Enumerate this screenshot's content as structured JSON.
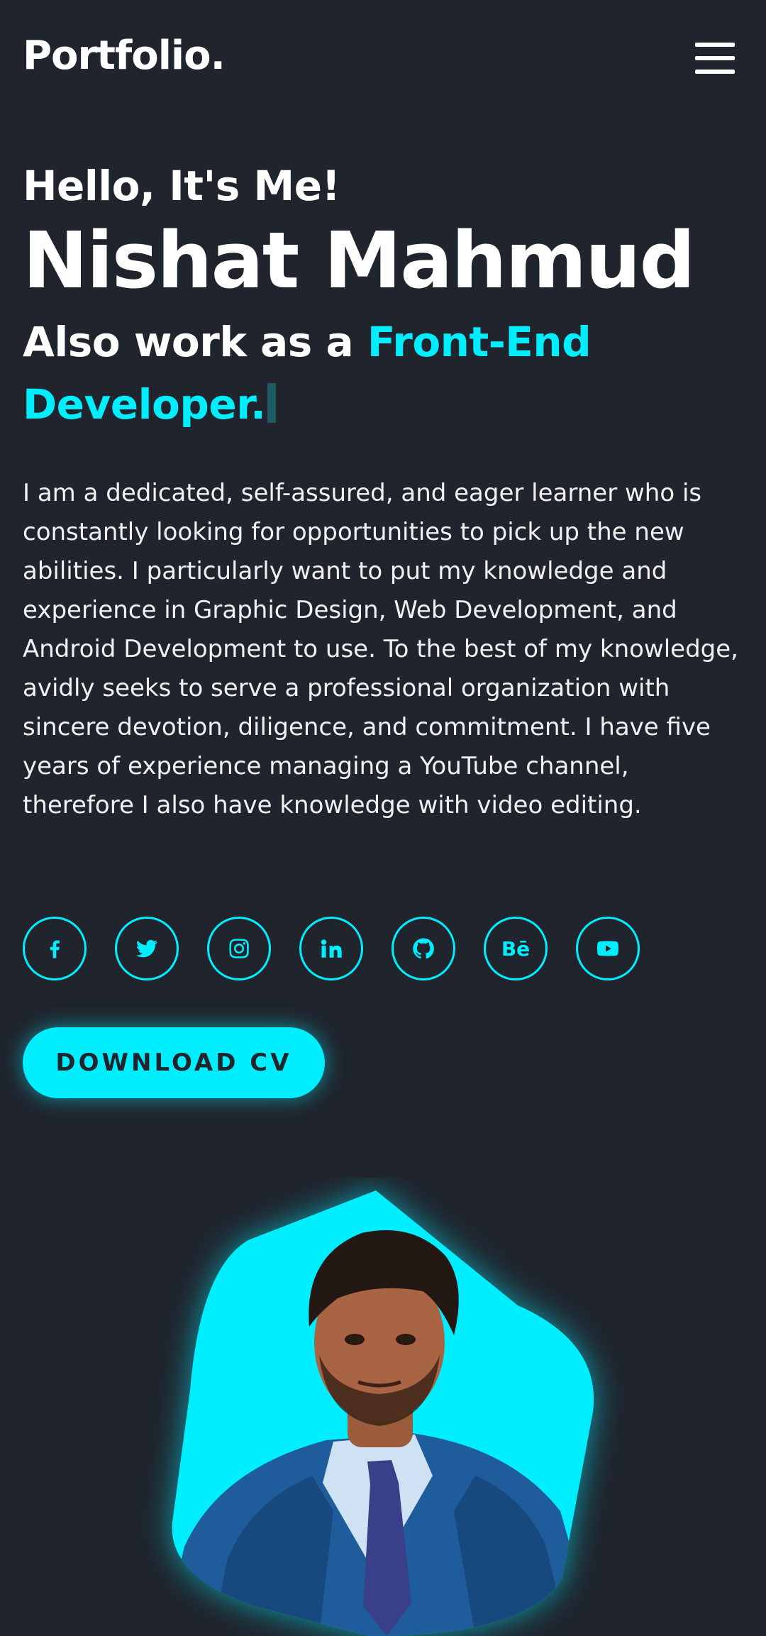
{
  "header": {
    "logo": "Portfolio.",
    "menu_icon": "hamburger-menu-icon"
  },
  "home": {
    "greeting": "Hello, It's Me!",
    "name": "Nishat Mahmud",
    "role_prefix": "Also work as a ",
    "role_typed": "Front-End Developer.",
    "bio": "I am a dedicated, self-assured, and eager learner who is constantly looking for opportunities to pick up the new abilities. I particularly want to put my knowledge and experience in Graphic Design, Web Development, and Android Development to use. To the best of my knowledge, avidly seeks to serve a professional organization with sincere devotion, diligence, and commitment. I have five years of experience managing a YouTube channel, therefore I also have knowledge with video editing.",
    "social": [
      {
        "icon": "facebook-icon"
      },
      {
        "icon": "twitter-icon"
      },
      {
        "icon": "instagram-icon"
      },
      {
        "icon": "linkedin-icon"
      },
      {
        "icon": "github-icon"
      },
      {
        "icon": "behance-icon",
        "text": "Bē"
      },
      {
        "icon": "youtube-icon"
      }
    ],
    "cv_button": "DOWNLOAD CV",
    "photo_icon": "profile-photo"
  },
  "colors": {
    "background": "#1f242d",
    "accent": "#00eeff",
    "text": "#ffffff"
  }
}
